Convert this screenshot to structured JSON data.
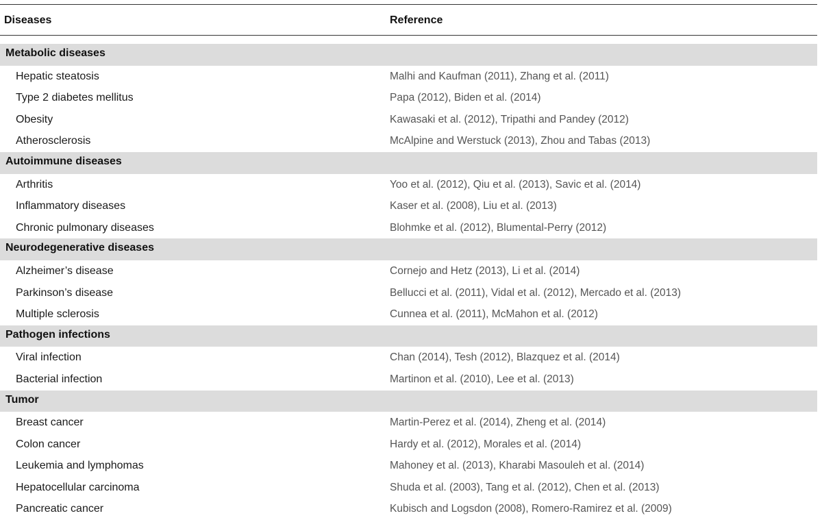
{
  "header": {
    "col1": "Diseases",
    "col2": "Reference"
  },
  "groups": [
    {
      "label": "Metabolic diseases",
      "items": [
        {
          "disease": "Hepatic steatosis",
          "ref": "Malhi and Kaufman (2011), Zhang et al. (2011)"
        },
        {
          "disease": "Type 2 diabetes mellitus",
          "ref": "Papa (2012), Biden et al. (2014)"
        },
        {
          "disease": "Obesity",
          "ref": "Kawasaki et al. (2012), Tripathi and Pandey (2012)"
        },
        {
          "disease": "Atherosclerosis",
          "ref": "McAlpine and Werstuck (2013), Zhou and Tabas (2013)"
        }
      ]
    },
    {
      "label": "Autoimmune diseases",
      "items": [
        {
          "disease": "Arthritis",
          "ref": "Yoo et al. (2012), Qiu et al. (2013), Savic et al. (2014)"
        },
        {
          "disease": "Inflammatory diseases",
          "ref": "Kaser et al. (2008), Liu et al. (2013)"
        },
        {
          "disease": "Chronic pulmonary diseases",
          "ref": "Blohmke et al. (2012), Blumental-Perry (2012)"
        }
      ]
    },
    {
      "label": "Neurodegenerative diseases",
      "items": [
        {
          "disease": "Alzheimer’s disease",
          "ref": "Cornejo and Hetz (2013), Li et al. (2014)"
        },
        {
          "disease": "Parkinson’s disease",
          "ref": "Bellucci et al. (2011), Vidal et al. (2012), Mercado et al. (2013)"
        },
        {
          "disease": "Multiple sclerosis",
          "ref": "Cunnea et al. (2011), McMahon et al. (2012)"
        }
      ]
    },
    {
      "label": "Pathogen infections",
      "items": [
        {
          "disease": "Viral infection",
          "ref": "Chan (2014), Tesh (2012), Blazquez et al. (2014)"
        },
        {
          "disease": "Bacterial infection",
          "ref": "Martinon et al. (2010), Lee et al. (2013)"
        }
      ]
    },
    {
      "label": "Tumor",
      "items": [
        {
          "disease": "Breast cancer",
          "ref": "Martin-Perez et al. (2014), Zheng et al. (2014)"
        },
        {
          "disease": "Colon cancer",
          "ref": "Hardy et al. (2012), Morales et al. (2014)"
        },
        {
          "disease": "Leukemia and lymphomas",
          "ref": "Mahoney et al. (2013), Kharabi Masouleh et al. (2014)"
        },
        {
          "disease": "Hepatocellular carcinoma",
          "ref": "Shuda et al. (2003), Tang et al. (2012), Chen et al. (2013)"
        },
        {
          "disease": "Pancreatic cancer",
          "ref": "Kubisch and Logsdon (2008), Romero-Ramirez et al. (2009)"
        }
      ]
    }
  ]
}
